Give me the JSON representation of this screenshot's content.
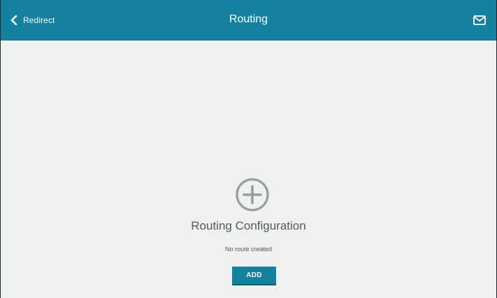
{
  "header": {
    "back_label": "Redirect",
    "title": "Routing",
    "back_icon": "chevron-left-icon",
    "mail_icon": "envelope-icon"
  },
  "main": {
    "empty_state": {
      "icon": "plus-circle-icon",
      "title": "Routing Configuration",
      "message": "No route created",
      "add_label": "ADD"
    }
  },
  "colors": {
    "header_bg": "#14819f",
    "content_bg": "#eff0f0",
    "icon_gray": "#9a9d9f",
    "text_gray": "#555a5e"
  }
}
